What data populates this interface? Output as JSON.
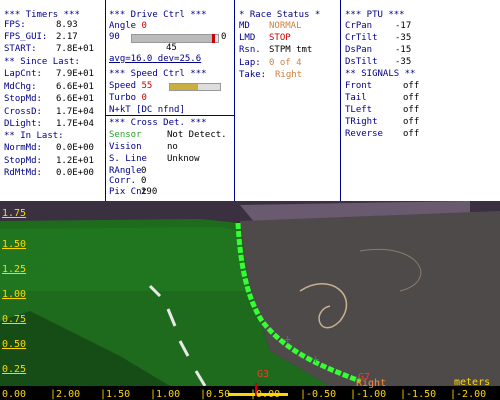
{
  "timers": {
    "header": "*** Timers ***",
    "rows": [
      {
        "label": "FPS:",
        "value": "8.93"
      },
      {
        "label": "FPS_GUI:",
        "value": "2.17"
      },
      {
        "label": "START:",
        "value": "7.8E+01"
      }
    ],
    "since_header": "** Since Last:",
    "since_rows": [
      {
        "label": "LapCnt:",
        "value": "7.9E+01"
      },
      {
        "label": "MdChg:",
        "value": "6.6E+01"
      },
      {
        "label": "StopMd:",
        "value": "6.6E+01"
      },
      {
        "label": "CrossD:",
        "value": "1.7E+04"
      },
      {
        "label": "DLight:",
        "value": "1.7E+04"
      }
    ],
    "in_header": "** In Last:",
    "in_rows": [
      {
        "label": "NormMd:",
        "value": "0.0E+00"
      },
      {
        "label": "StopMd:",
        "value": "1.2E+01"
      },
      {
        "label": "RdMtMd:",
        "value": "0.0E+00"
      }
    ]
  },
  "drive": {
    "header": "***  Drive Ctrl  ***",
    "angle_label": "Angle",
    "angle_value": "0",
    "bar_left": "90",
    "bar_right": "0",
    "bar_level": 0.93,
    "center_value": "45",
    "avg": "avg=16.0",
    "dev": "dev=25.6",
    "speed_header": "***  Speed Ctrl  ***",
    "speed_label": "Speed",
    "speed_value": "55",
    "speed_level": 0.55,
    "turbo_label": "Turbo",
    "turbo_value": "0",
    "nkt": "N+kT [DC nfnd]",
    "cross_header": "*** Cross Det. ***",
    "cross_rows": [
      {
        "label": "Sensor",
        "value": "Not Detect."
      },
      {
        "label": "Vision",
        "value": "no"
      },
      {
        "label": "S. Line",
        "value": "Unknow"
      },
      {
        "label": "RAngle",
        "value": "0"
      },
      {
        "label": "Corr.",
        "value": "0"
      },
      {
        "label": "Pix Cnt",
        "value": "290"
      }
    ]
  },
  "race": {
    "header": "* Race Status *",
    "rows": [
      {
        "label": "MD",
        "value": "NORMAL"
      },
      {
        "label": "LMD",
        "value": "STOP"
      },
      {
        "label": "Rsn.",
        "value": "STPM tmt"
      },
      {
        "label": "Lap:",
        "value": "0 of 4"
      },
      {
        "label": "Take:",
        "value": "Right"
      }
    ]
  },
  "ptu": {
    "header": "*** PTU ***",
    "rows": [
      {
        "label": "CrPan",
        "value": "-17"
      },
      {
        "label": "CrTilt",
        "value": "-35"
      },
      {
        "label": "DsPan",
        "value": "-15"
      },
      {
        "label": "DsTilt",
        "value": "-35"
      }
    ],
    "signals_header": "** SIGNALS **",
    "signals": [
      {
        "label": "Front",
        "value": "off"
      },
      {
        "label": "Tail",
        "value": "off"
      },
      {
        "label": "TLeft",
        "value": "off"
      },
      {
        "label": "TRight",
        "value": "off"
      },
      {
        "label": "Reverse",
        "value": "off"
      }
    ]
  },
  "view": {
    "y_ticks": [
      "1.75",
      "1.50",
      "1.25",
      "1.00",
      "0.75",
      "0.50",
      "0.25"
    ],
    "x_ticks": [
      "0.00",
      "2.00",
      "1.50",
      "1.00",
      "0.50",
      "0.00",
      "-0.50",
      "-1.00",
      "-1.50",
      "-2.00"
    ],
    "units": "meters",
    "marker_g3": "G3",
    "marker_g7": "G7",
    "marker_right": "Right"
  },
  "colors": {
    "separator": "#00008b",
    "label": "#00008b",
    "orange": "#d08040",
    "red": "#cc0000",
    "green": "#2aa02a",
    "axis": "#ffd700",
    "track": "#33ff33"
  }
}
